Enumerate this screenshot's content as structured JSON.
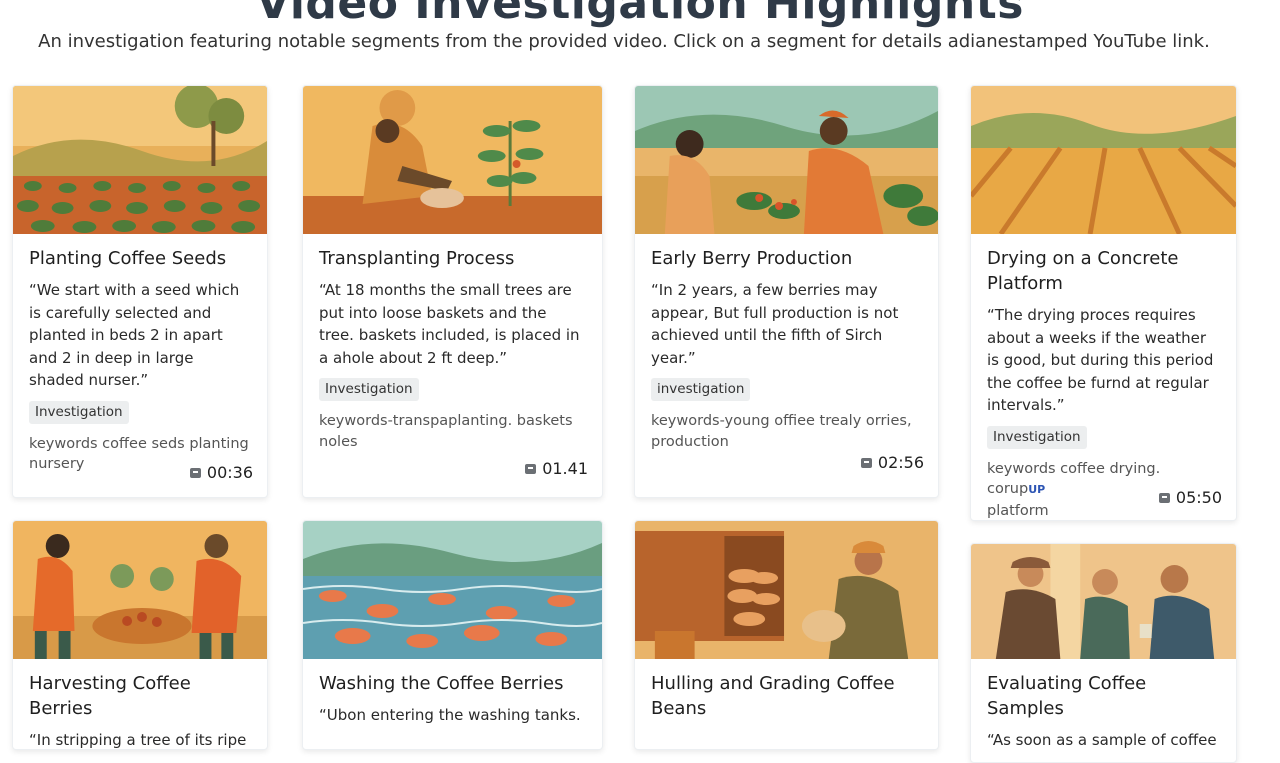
{
  "header": {
    "title": "Video Investigation Highlights",
    "subtitle": "An investigation featuring notable segments from the provided video. Click on a segment for details adianestamped YouTube link."
  },
  "cards": [
    {
      "title": "Planting Coffee Seeds",
      "quote": "“We start with a seed which is carefully selected and planted in beds 2 in apart and 2 in deep in large shaded nurser.”",
      "tag": "Investigation",
      "keywords": "keywords coffee seds planting nursery",
      "timestamp": "00:36"
    },
    {
      "title": "Transplanting Process",
      "quote": "“At 18 months the small trees are put into loose baskets and the tree. baskets included, is placed in a ahole about 2 ft deep.”",
      "tag": "Investigation",
      "keywords": "keywords-transpaplanting. baskets noles",
      "timestamp": "01.41"
    },
    {
      "title": "Early Berry Production",
      "quote": "“In 2 years, a few berries may appear, But full production is not achieved until the fifth of Sirch year.”",
      "tag": "investigation",
      "keywords": "keywords-young offiee trealy orries, production",
      "timestamp": "02:56"
    },
    {
      "title": "Drying on a Concrete Platform",
      "quote": "“The drying proces requires about a weeks if the weather is good, but during this period the coffee be furnd at regular intervals.”",
      "tag": "Investigation",
      "keywords": "keywords coffee  drying. corup",
      "keywords_badge": "UP",
      "keywords_line2": "platform",
      "timestamp": "05:50"
    },
    {
      "title": "Harvesting Coffee Berries",
      "quote": "“In stripping a tree of its ripe"
    },
    {
      "title": "Washing the Coffee Berries",
      "quote": "“Ubon entering the washing tanks."
    },
    {
      "title": "Hulling and Grading Coffee Beans",
      "quote": ""
    },
    {
      "title": "Evaluating Coffee Samples",
      "quote": "“As soon as a sample of coffee"
    }
  ],
  "icons": {
    "timestamp": "play-icon"
  },
  "colors": {
    "accent_blue": "#2d55b4",
    "tag_bg": "#eceeef",
    "title": "#2f3a47"
  }
}
